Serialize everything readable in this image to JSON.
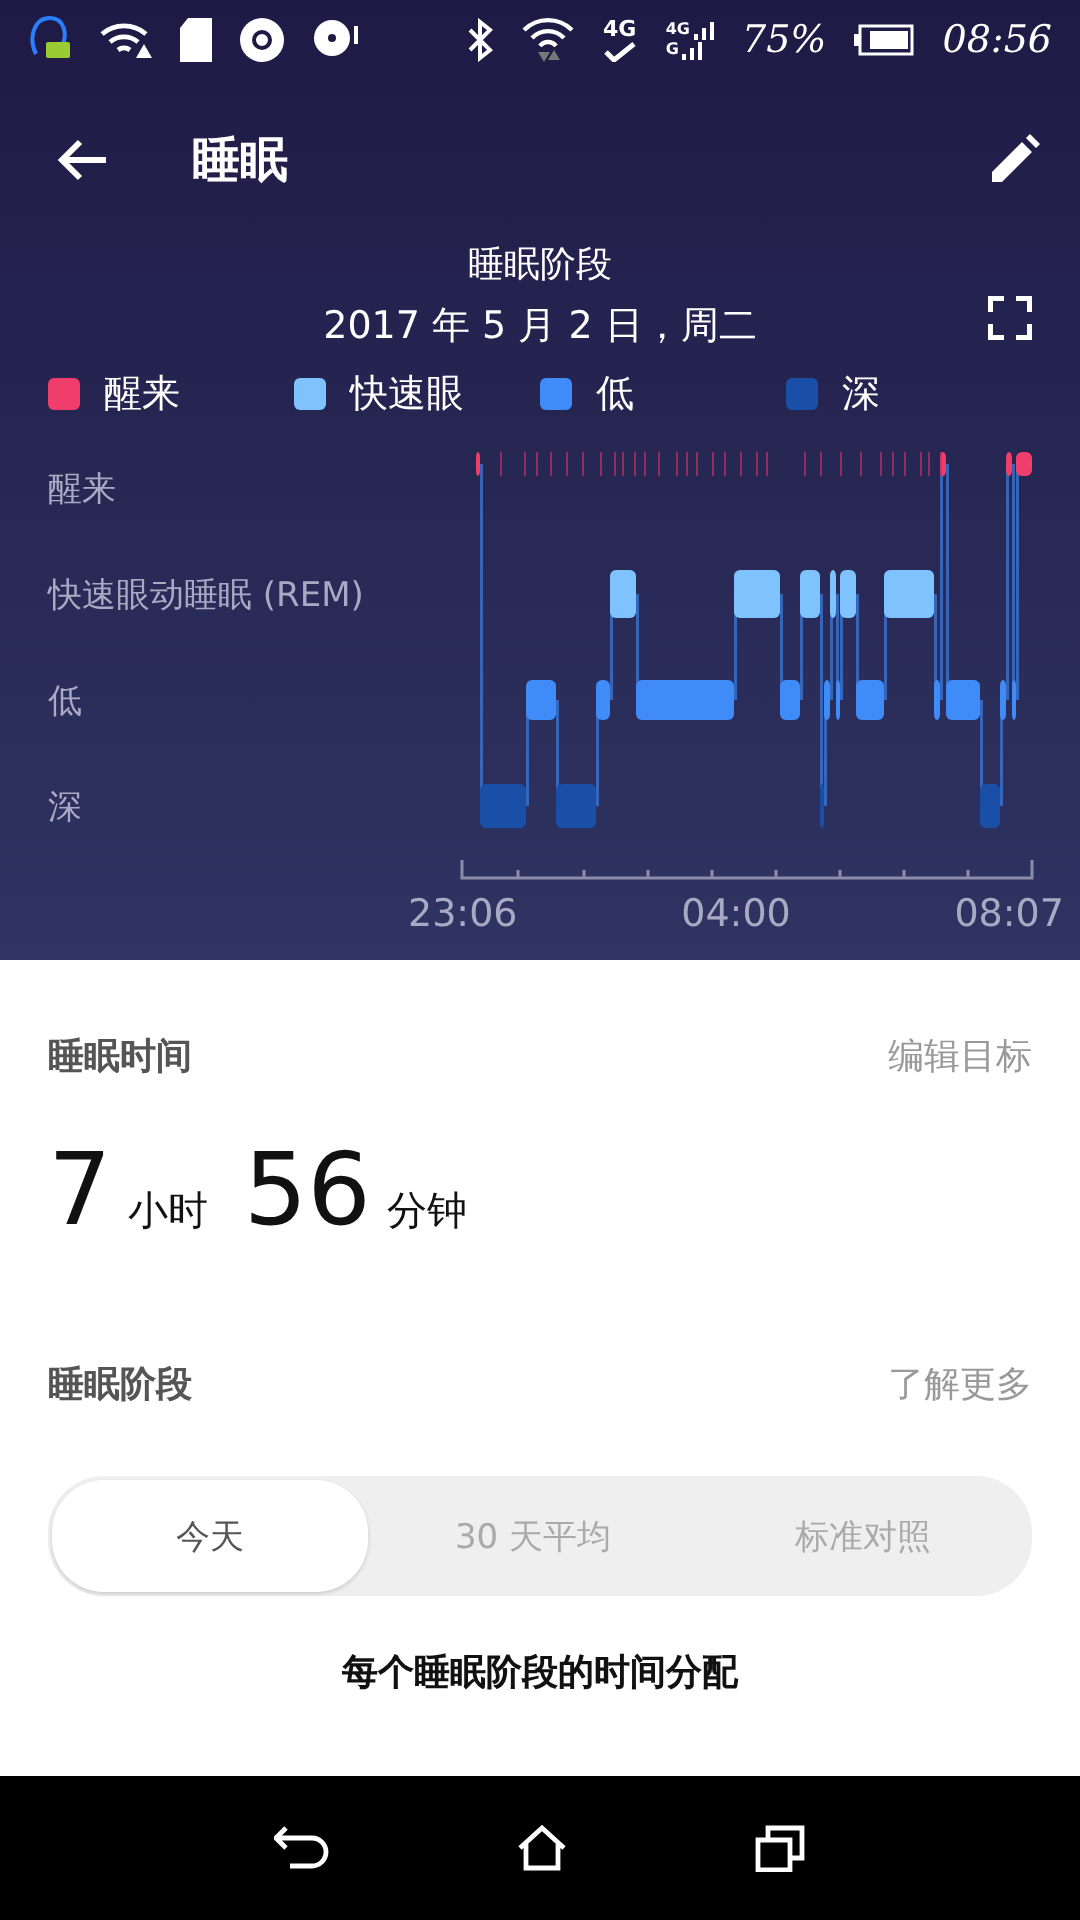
{
  "status_bar": {
    "network_type": "4G",
    "signal_labels": [
      "4G",
      "G"
    ],
    "battery": "75%",
    "time": "08:56"
  },
  "app_bar": {
    "title": "睡眠"
  },
  "chart_header": {
    "title": "睡眠阶段",
    "date": "2017 年 5 月 2 日，周二"
  },
  "legend": [
    {
      "label": "醒来",
      "color": "#f03e6c"
    },
    {
      "label": "快速眼",
      "color": "#7ec3fe"
    },
    {
      "label": "低",
      "color": "#3f8cf9"
    },
    {
      "label": "深",
      "color": "#1a4fa8"
    }
  ],
  "stage_labels": [
    "醒来",
    "快速眼动睡眠 (REM)",
    "低",
    "深"
  ],
  "time_labels": [
    "23:06",
    "04:00",
    "08:07"
  ],
  "sleep_time": {
    "heading": "睡眠时间",
    "link": "编辑目标",
    "hours": "7",
    "hours_unit": "小时",
    "minutes": "56",
    "minutes_unit": "分钟"
  },
  "stages": {
    "heading": "睡眠阶段",
    "link": "了解更多",
    "tabs": [
      {
        "label": "今天",
        "selected": true
      },
      {
        "label": "30 天平均",
        "selected": false
      },
      {
        "label": "标准对照",
        "selected": false
      }
    ],
    "caption": "每个睡眠阶段的时间分配"
  }
}
